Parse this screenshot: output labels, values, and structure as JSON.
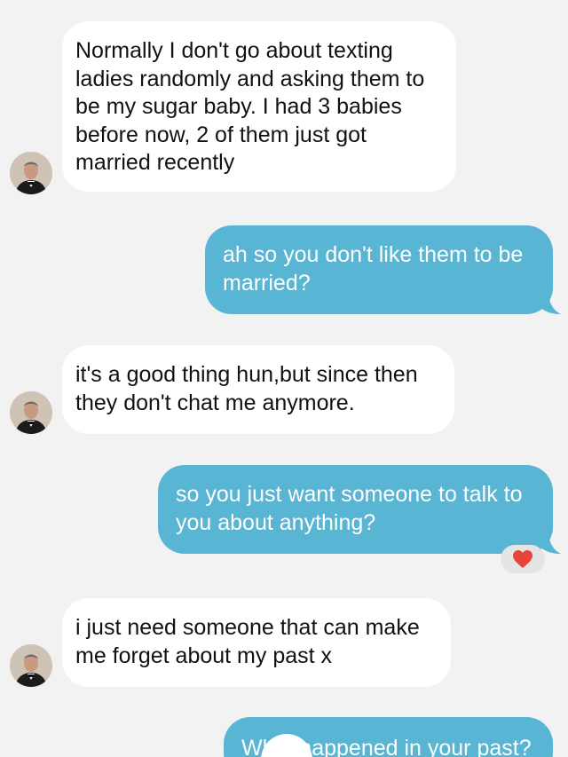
{
  "conversation": {
    "messages": [
      {
        "direction": "incoming",
        "text": "Normally I don't go about texting ladies randomly and asking them to be my sugar baby. I had 3 babies before now, 2 of them just got married recently"
      },
      {
        "direction": "outgoing",
        "text": "ah so you don't like them to be married?"
      },
      {
        "direction": "incoming",
        "text": "it's a good thing hun,but since then they don't chat me anymore."
      },
      {
        "direction": "outgoing",
        "text": "so you just want someone to talk to you about anything?",
        "reaction": "heart"
      },
      {
        "direction": "incoming",
        "text": "i just need someone that can make me forget about my past x"
      },
      {
        "direction": "outgoing",
        "text": "What happened in your past?"
      }
    ]
  },
  "colors": {
    "background": "#f2f2f2",
    "incoming_bubble": "#ffffff",
    "outgoing_bubble": "#58b5d3",
    "reaction_heart": "#e8443a"
  },
  "icons": {
    "reaction": "heart-icon",
    "avatar": "contact-avatar"
  }
}
